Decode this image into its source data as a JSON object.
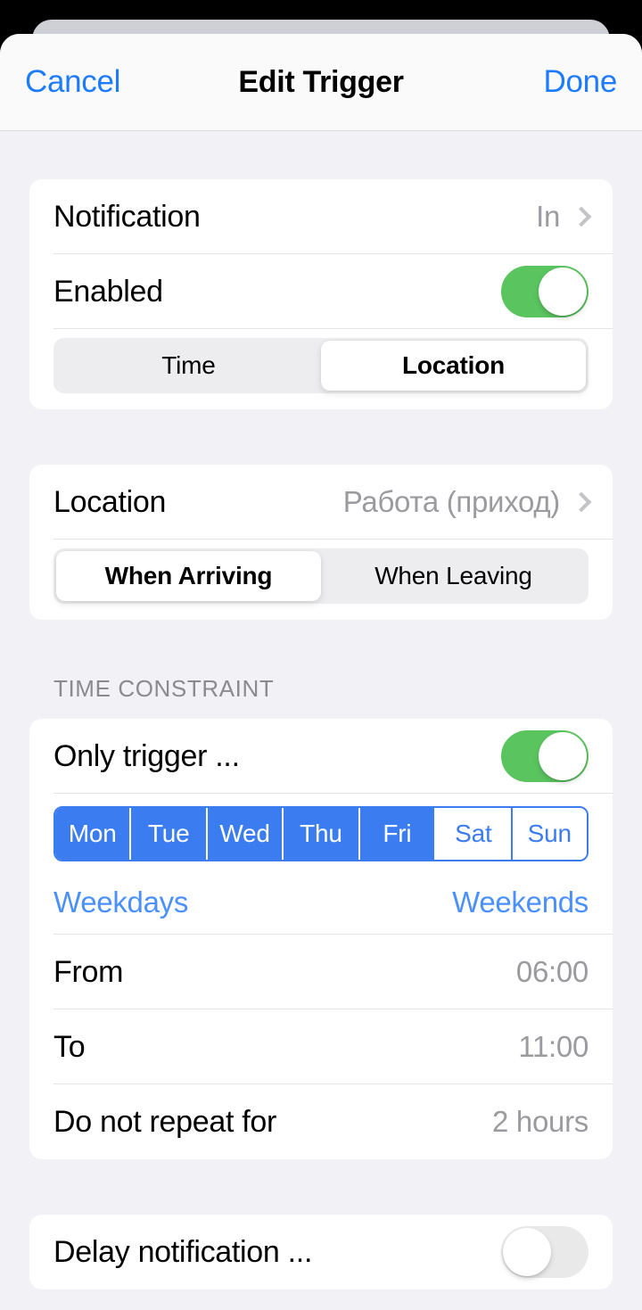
{
  "navbar": {
    "cancel_label": "Cancel",
    "title": "Edit Trigger",
    "done_label": "Done"
  },
  "trigger_card": {
    "notification_row": {
      "label": "Notification",
      "value": "In"
    },
    "enabled_row": {
      "label": "Enabled",
      "state": "on"
    },
    "type_segmented": {
      "options": [
        "Time",
        "Location"
      ],
      "selected": "Location"
    }
  },
  "location_card": {
    "location_row": {
      "label": "Location",
      "value": "Работа (приход)"
    },
    "direction_segmented": {
      "options": [
        "When Arriving",
        "When Leaving"
      ],
      "selected": "When Arriving"
    }
  },
  "time_constraint": {
    "section_header": "TIME CONSTRAINT",
    "only_trigger_row": {
      "label": "Only trigger ...",
      "state": "on"
    },
    "days": [
      {
        "label": "Mon",
        "selected": true
      },
      {
        "label": "Tue",
        "selected": true
      },
      {
        "label": "Wed",
        "selected": true
      },
      {
        "label": "Thu",
        "selected": true
      },
      {
        "label": "Fri",
        "selected": true
      },
      {
        "label": "Sat",
        "selected": false
      },
      {
        "label": "Sun",
        "selected": false
      }
    ],
    "shortcuts": {
      "weekdays_label": "Weekdays",
      "weekends_label": "Weekends"
    },
    "from_row": {
      "label": "From",
      "value": "06:00"
    },
    "to_row": {
      "label": "To",
      "value": "11:00"
    },
    "repeat_row": {
      "label": "Do not repeat for",
      "value": "2 hours"
    }
  },
  "delay_card": {
    "delay_row": {
      "label": "Delay notification ...",
      "state": "off"
    }
  },
  "colors": {
    "accent_blue": "#1d7bff",
    "link_blue": "#4a90ff",
    "day_blue": "#3b7df0",
    "switch_on_green": "#5ac45f",
    "switch_off_grey": "#e9e9ea",
    "page_background": "#f2f2f6",
    "card_background": "#ffffff",
    "value_grey": "#9a9a9f"
  }
}
